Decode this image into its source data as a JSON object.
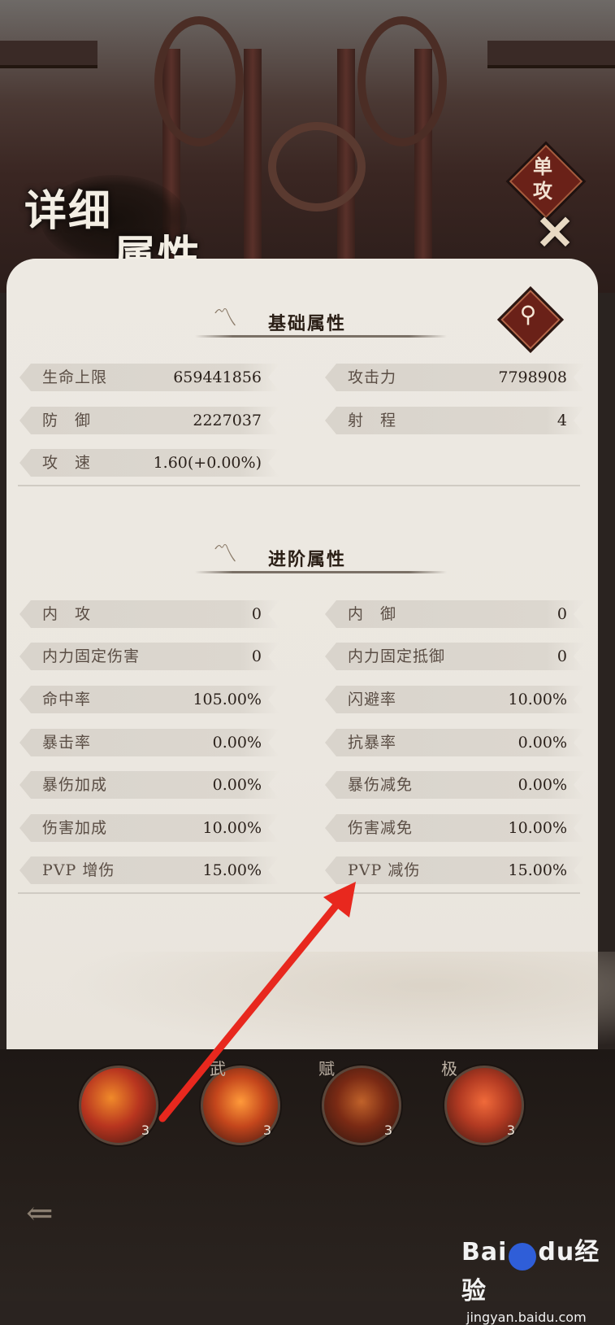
{
  "header": {
    "title_line1": "详细",
    "title_line2": "属性",
    "mode_badge": "单攻"
  },
  "sections": {
    "basic": {
      "title": "基础属性"
    },
    "advanced": {
      "title": "进阶属性"
    }
  },
  "basic_stats": [
    {
      "label": "生命上限",
      "value": "659441856"
    },
    {
      "label": "攻击力",
      "value": "7798908"
    },
    {
      "label": "防　御",
      "value": "2227037"
    },
    {
      "label": "射　程",
      "value": "4"
    },
    {
      "label": "攻　速",
      "value": "1.60(+0.00%)"
    }
  ],
  "advanced_stats": [
    {
      "label": "内　攻",
      "value": "0"
    },
    {
      "label": "内　御",
      "value": "0"
    },
    {
      "label": "内力固定伤害",
      "value": "0"
    },
    {
      "label": "内力固定抵御",
      "value": "0"
    },
    {
      "label": "命中率",
      "value": "105.00%"
    },
    {
      "label": "闪避率",
      "value": "10.00%"
    },
    {
      "label": "暴击率",
      "value": "0.00%"
    },
    {
      "label": "抗暴率",
      "value": "0.00%"
    },
    {
      "label": "暴伤加成",
      "value": "0.00%"
    },
    {
      "label": "暴伤减免",
      "value": "0.00%"
    },
    {
      "label": "伤害加成",
      "value": "10.00%"
    },
    {
      "label": "伤害减免",
      "value": "10.00%"
    },
    {
      "label": "PVP 增伤",
      "value": "15.00%"
    },
    {
      "label": "PVP 减伤",
      "value": "15.00%"
    }
  ],
  "skills": [
    {
      "tag": "",
      "level": "3",
      "color": "#b8351f"
    },
    {
      "tag": "武",
      "level": "3",
      "color": "#c4461c"
    },
    {
      "tag": "赋",
      "level": "3",
      "color": "#7a2a14"
    },
    {
      "tag": "极",
      "level": "3",
      "color": "#b23a22"
    }
  ],
  "watermark": {
    "brand": "Bai",
    "brand2": "du",
    "brand_cn": "经验",
    "site": "jingyan.baidu.com"
  },
  "colors": {
    "accent": "#6a2118",
    "arrow": "#e8281e"
  }
}
